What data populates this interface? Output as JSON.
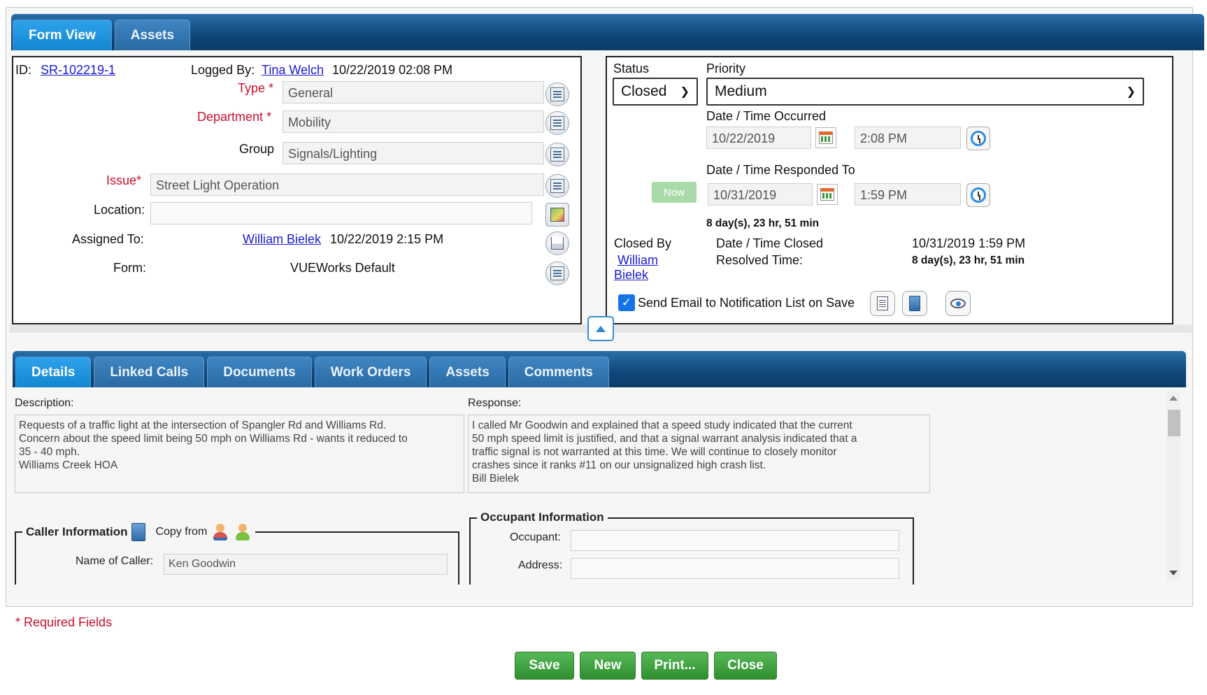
{
  "top_tabs": [
    "Form View",
    "Assets"
  ],
  "left": {
    "id_label": "ID:",
    "id_value": "SR-102219-1",
    "logged_by_label": "Logged By:",
    "logged_by_name": "Tina Welch",
    "logged_by_date": "10/22/2019 02:08 PM",
    "type_label": "Type",
    "type_value": "General",
    "department_label": "Department",
    "department_value": "Mobility",
    "group_label": "Group",
    "group_value": "Signals/Lighting",
    "issue_label": "Issue",
    "issue_value": "Street Light Operation",
    "location_label": "Location:",
    "location_value": "",
    "assigned_label": "Assigned To:",
    "assigned_name": "William Bielek",
    "assigned_date": "10/22/2019 2:15 PM",
    "form_label": "Form:",
    "form_value": "VUEWorks Default",
    "required_star": "*"
  },
  "right": {
    "status_label": "Status",
    "status_value": "Closed",
    "priority_label": "Priority",
    "priority_value": "Medium",
    "occurred_label": "Date / Time Occurred",
    "occurred_date": "10/22/2019",
    "occurred_time": "2:08 PM",
    "responded_label": "Date / Time Responded To",
    "now_label": "Now",
    "responded_date": "10/31/2019",
    "responded_time": "1:59 PM",
    "responded_elapsed": "8 day(s), 23 hr, 51 min",
    "closed_by_label": "Closed By",
    "closed_by_name_1": "William",
    "closed_by_name_2": "Bielek",
    "date_closed_label": "Date / Time Closed",
    "date_closed_value": "10/31/2019 1:59 PM",
    "resolved_label": "Resolved Time:",
    "resolved_value": "8 day(s), 23 hr, 51 min",
    "send_email_label": "Send Email to Notification List on Save",
    "send_email_checked": true
  },
  "detail_tabs": [
    "Details",
    "Linked Calls",
    "Documents",
    "Work Orders",
    "Assets",
    "Comments"
  ],
  "details": {
    "description_label": "Description:",
    "description_text": "Requests of a traffic light at the intersection of Spangler Rd and Williams Rd.\nConcern about the speed limit being 50 mph on Williams Rd - wants it reduced to\n35 - 40 mph.\nWilliams Creek HOA",
    "response_label": "Response:",
    "response_text": "I called Mr Goodwin and explained that a speed study indicated that the current\n50 mph speed limit is justified, and that a signal warrant analysis indicated that a\ntraffic signal is not warranted at this time. We will continue to closely monitor\ncrashes since it ranks #11 on our unsignalized high crash list.\nBill Bielek",
    "caller_legend": "Caller Information",
    "copy_from_label": "Copy from",
    "caller_name_label": "Name of Caller:",
    "caller_name_value": "Ken Goodwin",
    "occupant_legend": "Occupant Information",
    "occupant_label": "Occupant:",
    "occupant_value": "",
    "address_label": "Address:",
    "address_value": ""
  },
  "footer": {
    "required_note": "* Required Fields",
    "buttons": [
      "Save",
      "New",
      "Print...",
      "Close"
    ]
  },
  "colors": {
    "tabbar": "#0f4679",
    "active_tab": "#1386d2",
    "required": "#c8102e",
    "link": "#1a1ad0",
    "button_green": "#2f8f2f"
  }
}
